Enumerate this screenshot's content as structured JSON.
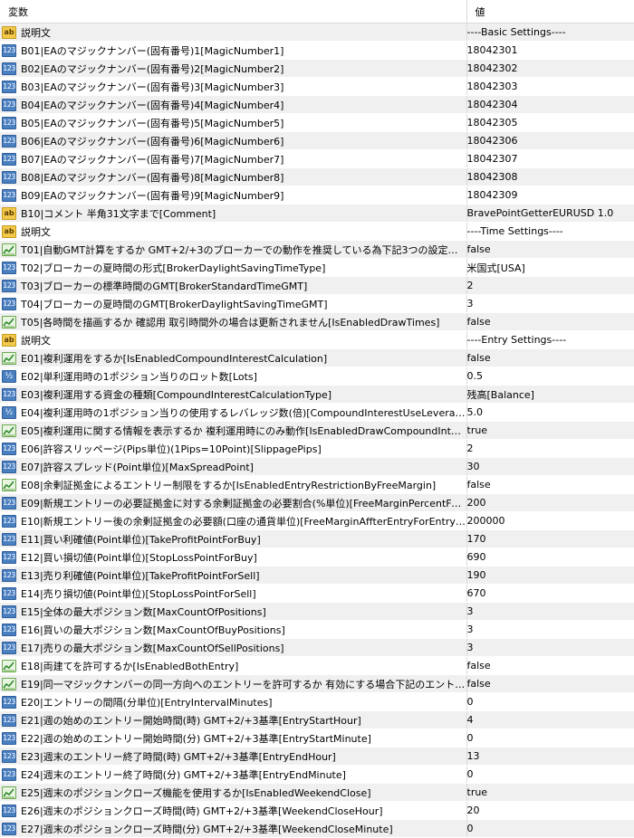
{
  "header": {
    "col_name": "変数",
    "col_value": "値"
  },
  "rows": [
    {
      "icon": "ab",
      "name": "説明文",
      "value": "----Basic Settings----"
    },
    {
      "icon": "123",
      "name": "B01|EAのマジックナンバー(固有番号)1[MagicNumber1]",
      "value": "18042301"
    },
    {
      "icon": "123",
      "name": "B02|EAのマジックナンバー(固有番号)2[MagicNumber2]",
      "value": "18042302"
    },
    {
      "icon": "123",
      "name": "B03|EAのマジックナンバー(固有番号)3[MagicNumber3]",
      "value": "18042303"
    },
    {
      "icon": "123",
      "name": "B04|EAのマジックナンバー(固有番号)4[MagicNumber4]",
      "value": "18042304"
    },
    {
      "icon": "123",
      "name": "B05|EAのマジックナンバー(固有番号)5[MagicNumber5]",
      "value": "18042305"
    },
    {
      "icon": "123",
      "name": "B06|EAのマジックナンバー(固有番号)6[MagicNumber6]",
      "value": "18042306"
    },
    {
      "icon": "123",
      "name": "B07|EAのマジックナンバー(固有番号)7[MagicNumber7]",
      "value": "18042307"
    },
    {
      "icon": "123",
      "name": "B08|EAのマジックナンバー(固有番号)8[MagicNumber8]",
      "value": "18042308"
    },
    {
      "icon": "123",
      "name": "B09|EAのマジックナンバー(固有番号)9[MagicNumber9]",
      "value": "18042309"
    },
    {
      "icon": "ab",
      "name": "B10|コメント 半角31文字まで[Comment]",
      "value": "BravePointGetterEURUSD 1.0"
    },
    {
      "icon": "ab",
      "name": "説明文",
      "value": "----Time Settings----"
    },
    {
      "icon": "bool",
      "name": "T01|自動GMT計算をするか GMT+2/+3のブローカーでの動作を推奨している為下記3つの設定で固定...",
      "value": "false"
    },
    {
      "icon": "123",
      "name": "T02|ブローカーの夏時間の形式[BrokerDaylightSavingTimeType]",
      "value": "米国式[USA]"
    },
    {
      "icon": "123",
      "name": "T03|ブローカーの標準時間のGMT[BrokerStandardTimeGMT]",
      "value": "2"
    },
    {
      "icon": "123",
      "name": "T04|ブローカーの夏時間のGMT[BrokerDaylightSavingTimeGMT]",
      "value": "3"
    },
    {
      "icon": "bool",
      "name": "T05|各時間を描画するか 確認用 取引時間外の場合は更新されません[IsEnabledDrawTimes]",
      "value": "false"
    },
    {
      "icon": "ab",
      "name": "説明文",
      "value": "----Entry Settings----"
    },
    {
      "icon": "bool",
      "name": "E01|複利運用をするか[IsEnabledCompoundInterestCalculation]",
      "value": "false"
    },
    {
      "icon": "dbl",
      "name": "E02|単利運用時の1ポジション当りのロット数[Lots]",
      "value": "0.5"
    },
    {
      "icon": "123",
      "name": "E03|複利運用する資金の種類[CompoundInterestCalculationType]",
      "value": "残高[Balance]"
    },
    {
      "icon": "dbl",
      "name": "E04|複利運用時の1ポジション当りの使用するレバレッジ数(倍)[CompoundInterestUseLeverage]",
      "value": "5.0"
    },
    {
      "icon": "bool",
      "name": "E05|複利運用に関する情報を表示するか 複利運用時にのみ動作[IsEnabledDrawCompoundInter...",
      "value": "true"
    },
    {
      "icon": "123",
      "name": "E06|許容スリッページ(Pips単位)(1Pips=10Point)[SlippagePips]",
      "value": "2"
    },
    {
      "icon": "123",
      "name": "E07|許容スプレッド(Point単位)[MaxSpreadPoint]",
      "value": "30"
    },
    {
      "icon": "bool",
      "name": "E08|余剰証拠金によるエントリー制限をするか[IsEnabledEntryRestrictionByFreeMargin]",
      "value": "false"
    },
    {
      "icon": "123",
      "name": "E09|新規エントリーの必要証拠金に対する余剰証拠金の必要割合(%単位)[FreeMarginPercentFor...",
      "value": "200"
    },
    {
      "icon": "123",
      "name": "E10|新規エントリー後の余剰証拠金の必要額(口座の通貨単位)[FreeMarginAffterEntryForEntryRe",
      "value": "200000"
    },
    {
      "icon": "123",
      "name": "E11|買い利確値(Point単位)[TakeProfitPointForBuy]",
      "value": "170"
    },
    {
      "icon": "123",
      "name": "E12|買い損切値(Point単位)[StopLossPointForBuy]",
      "value": "690"
    },
    {
      "icon": "123",
      "name": "E13|売り利確値(Point単位)[TakeProfitPointForSell]",
      "value": "190"
    },
    {
      "icon": "123",
      "name": "E14|売り損切値(Point単位)[StopLossPointForSell]",
      "value": "670"
    },
    {
      "icon": "123",
      "name": "E15|全体の最大ポジション数[MaxCountOfPositions]",
      "value": "3"
    },
    {
      "icon": "123",
      "name": "E16|買いの最大ポジション数[MaxCountOfBuyPositions]",
      "value": "3"
    },
    {
      "icon": "123",
      "name": "E17|売りの最大ポジション数[MaxCountOfSellPositions]",
      "value": "3"
    },
    {
      "icon": "bool",
      "name": "E18|両建てを許可するか[IsEnabledBothEntry]",
      "value": "false"
    },
    {
      "icon": "bool",
      "name": "E19|同一マジックナンバーの同一方向へのエントリーを許可するか 有効にする場合下記のエントリーの間・...",
      "value": "false"
    },
    {
      "icon": "123",
      "name": "E20|エントリーの間隔(分単位)[EntryIntervalMinutes]",
      "value": "0"
    },
    {
      "icon": "123",
      "name": "E21|週の始めのエントリー開始時間(時) GMT+2/+3基準[EntryStartHour]",
      "value": "4"
    },
    {
      "icon": "123",
      "name": "E22|週の始めのエントリー開始時間(分) GMT+2/+3基準[EntryStartMinute]",
      "value": "0"
    },
    {
      "icon": "123",
      "name": "E23|週末のエントリー終了時間(時) GMT+2/+3基準[EntryEndHour]",
      "value": "13"
    },
    {
      "icon": "123",
      "name": "E24|週末のエントリー終了時間(分) GMT+2/+3基準[EntryEndMinute]",
      "value": "0"
    },
    {
      "icon": "bool",
      "name": "E25|週末のポジションクローズ機能を使用するか[IsEnabledWeekendClose]",
      "value": "true"
    },
    {
      "icon": "123",
      "name": "E26|週末のポジションクローズ時間(時) GMT+2/+3基準[WeekendCloseHour]",
      "value": "20"
    },
    {
      "icon": "123",
      "name": "E27|週末のポジションクローズ時間(分) GMT+2/+3基準[WeekendCloseMinute]",
      "value": "0"
    }
  ]
}
